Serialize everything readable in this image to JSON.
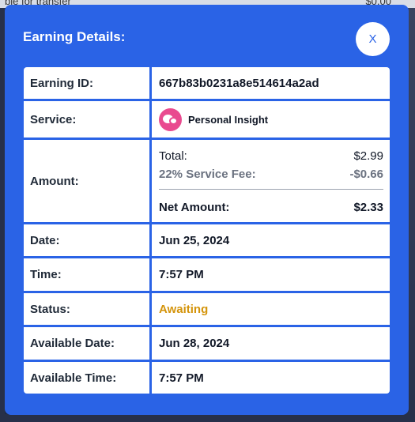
{
  "background": {
    "left_text": "ble for transfer",
    "right_text": "$0.00"
  },
  "modal": {
    "title": "Earning Details:",
    "close_label": "X"
  },
  "details": {
    "earning_id_label": "Earning ID:",
    "earning_id_value": "667b83b0231a8e514614a2ad",
    "service_label": "Service:",
    "service_icon": "chat-bubbles-icon",
    "service_name": "Personal Insight",
    "amount_label": "Amount:",
    "total_label": "Total:",
    "total_value": "$2.99",
    "fee_label": "22% Service Fee:",
    "fee_value": "-$0.66",
    "net_label": "Net Amount:",
    "net_value": "$2.33",
    "date_label": "Date:",
    "date_value": "Jun 25, 2024",
    "time_label": "Time:",
    "time_value": "7:57 PM",
    "status_label": "Status:",
    "status_value": "Awaiting",
    "available_date_label": "Available Date:",
    "available_date_value": "Jun 28, 2024",
    "available_time_label": "Available Time:",
    "available_time_value": "7:57 PM"
  },
  "colors": {
    "modal_bg": "#2a63e6",
    "status_awaiting": "#d4940b",
    "service_icon_bg": "#e94a8f"
  }
}
